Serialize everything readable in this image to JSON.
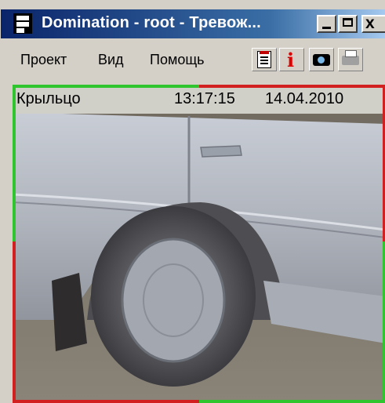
{
  "window": {
    "title": "Domination - root - Тревож...",
    "controls": {
      "minimize": "_",
      "maximize": "□",
      "close": "x"
    }
  },
  "menu": {
    "items": [
      {
        "label": "Проект"
      },
      {
        "label": "Вид"
      },
      {
        "label": "Помощь"
      }
    ]
  },
  "toolbar": {
    "buttons": [
      {
        "icon": "camera-list-icon"
      },
      {
        "icon": "info-icon",
        "glyph": "i"
      },
      {
        "icon": "snapshot-camera-icon"
      },
      {
        "icon": "print-icon"
      }
    ]
  },
  "camera": {
    "name": "Крыльцо",
    "time": "13:17:15",
    "date": "14.04.2010"
  },
  "colors": {
    "alarm_green": "#2fc52f",
    "alarm_red": "#d22020",
    "titlebar_start": "#0a246a",
    "titlebar_end": "#a6caf0"
  }
}
